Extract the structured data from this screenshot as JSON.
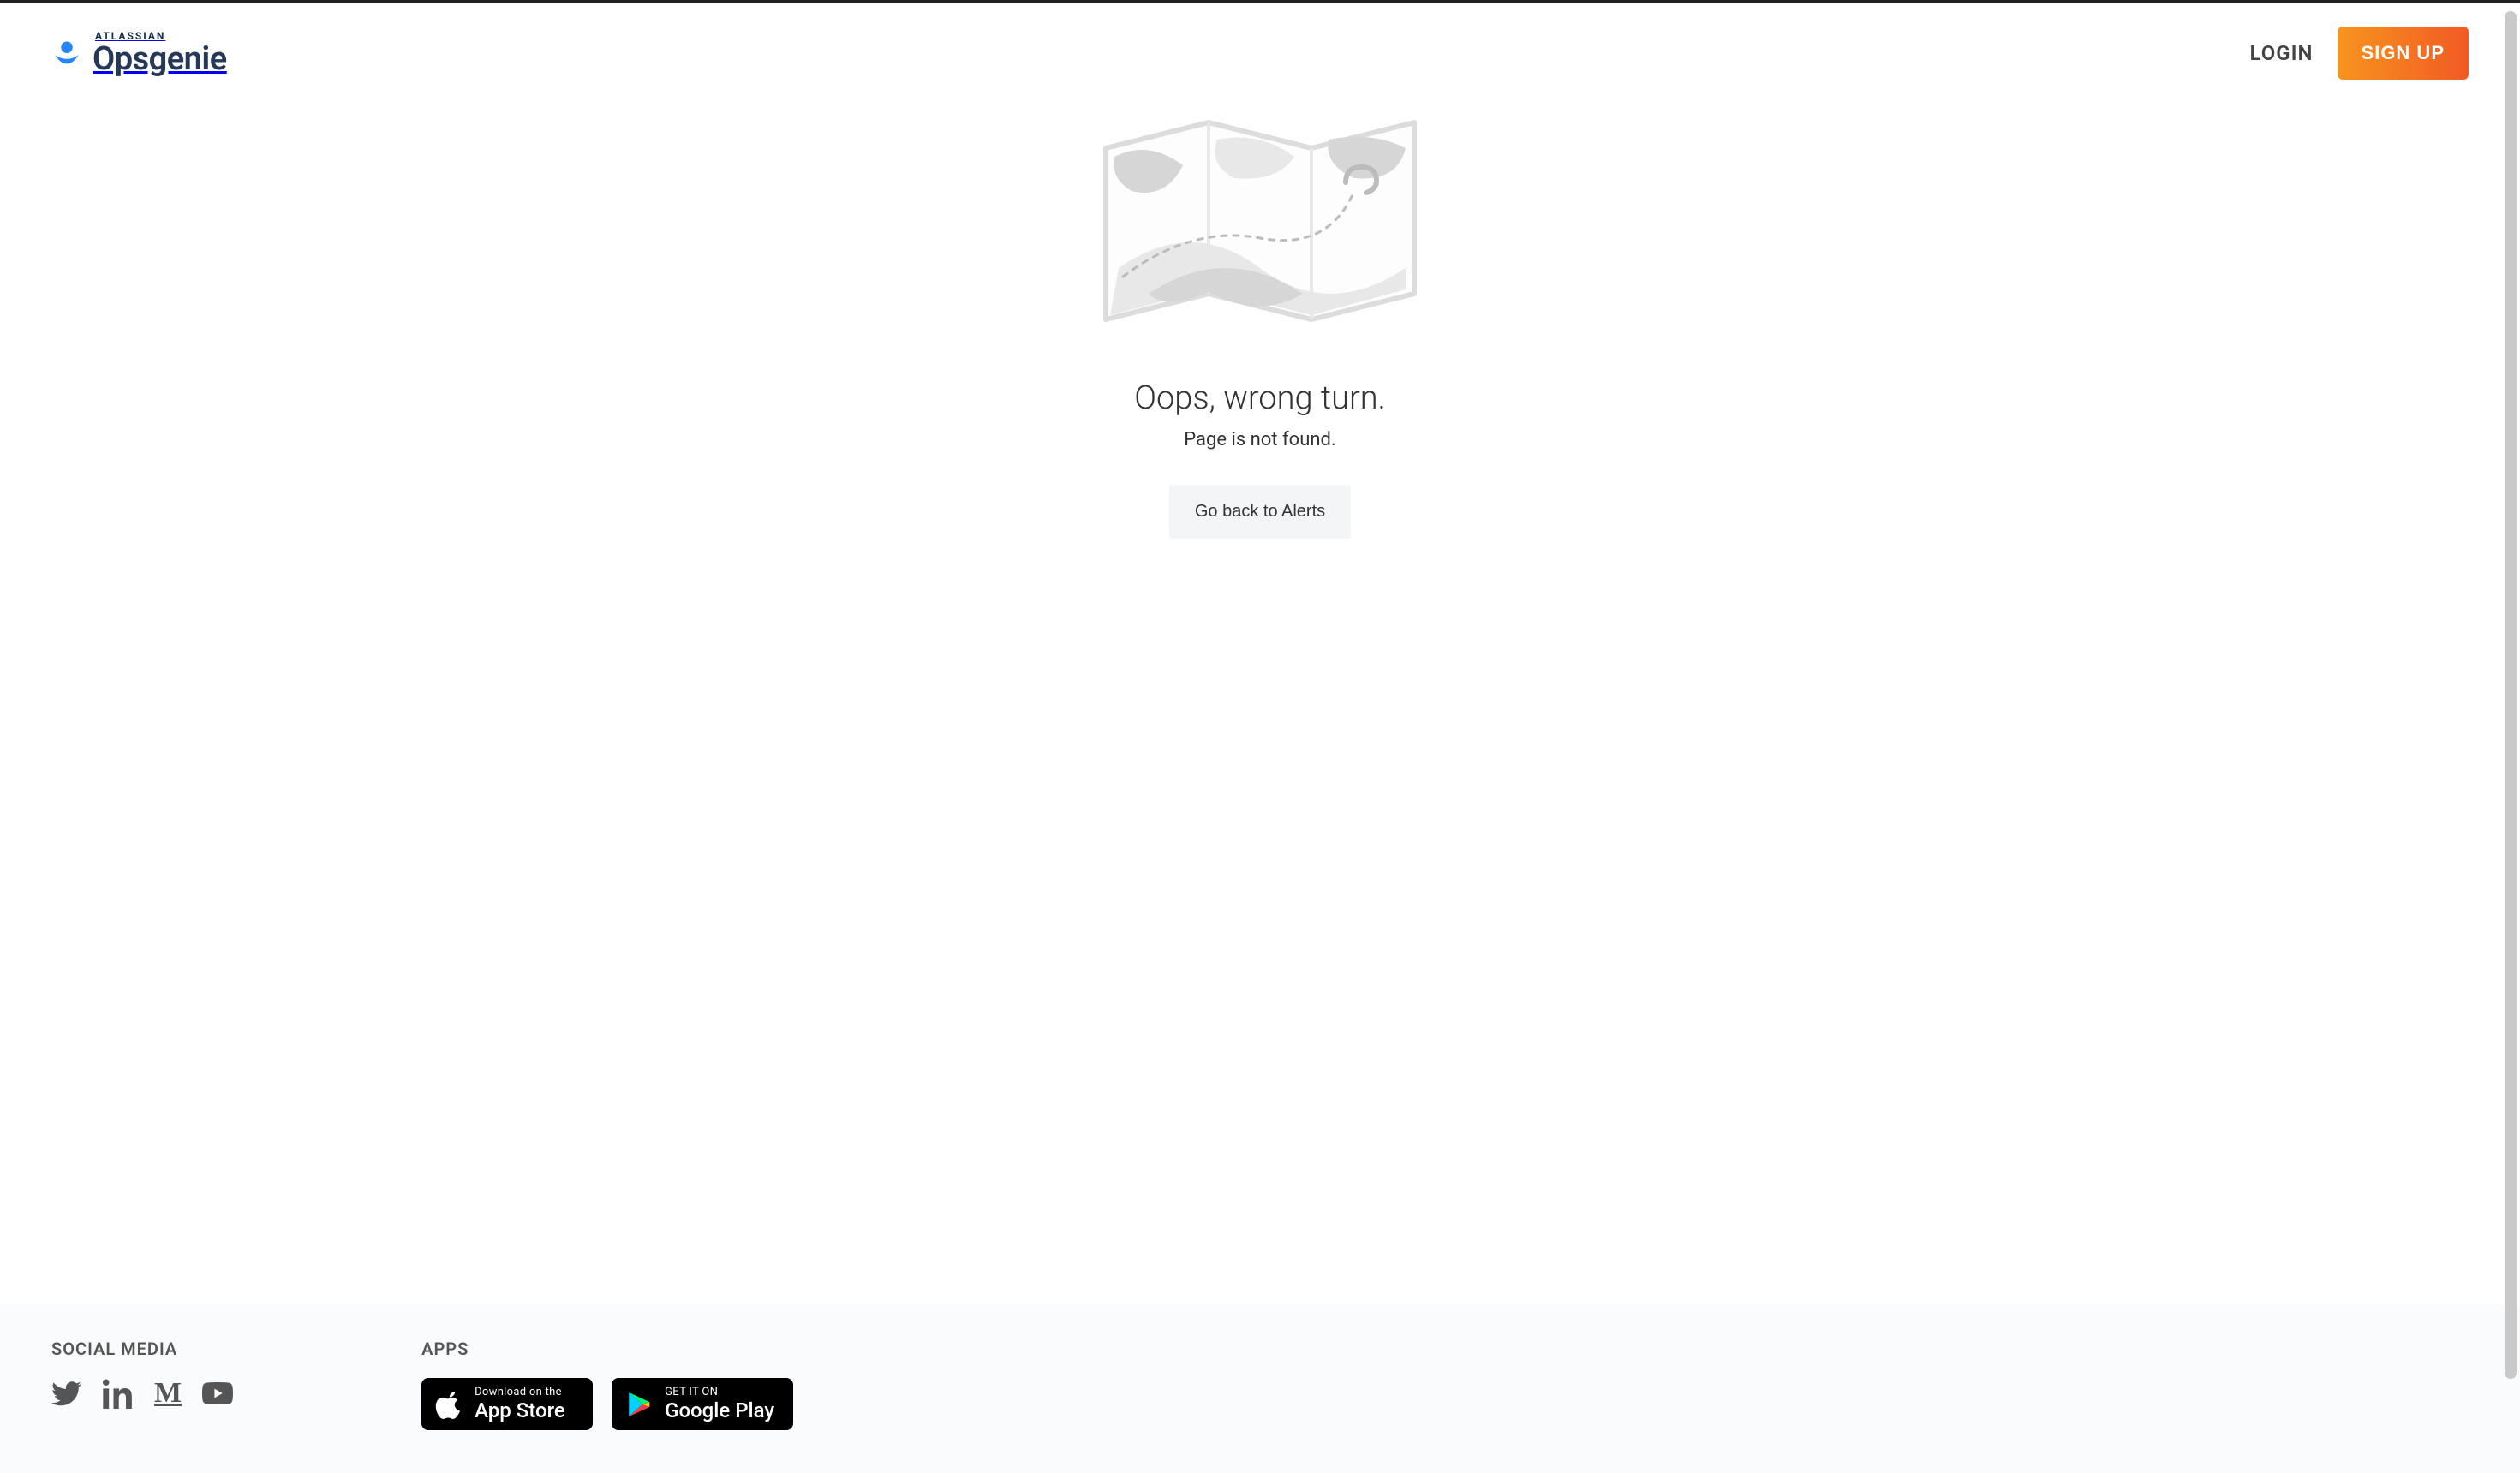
{
  "header": {
    "brand_sup": "ATLASSIAN",
    "brand": "Opsgenie",
    "login_label": "LOGIN",
    "signup_label": "SIGN UP"
  },
  "main": {
    "heading": "Oops, wrong turn.",
    "subheading": "Page is not found.",
    "back_label": "Go back to Alerts"
  },
  "footer": {
    "social_heading": "SOCIAL MEDIA",
    "apps_heading": "APPS",
    "appstore_top": "Download on the",
    "appstore_bottom": "App Store",
    "play_top": "GET IT ON",
    "play_bottom": "Google Play"
  },
  "colors": {
    "brand_blue": "#2684FF",
    "signup_gradient_start": "#F7941E",
    "signup_gradient_end": "#F15A24"
  }
}
